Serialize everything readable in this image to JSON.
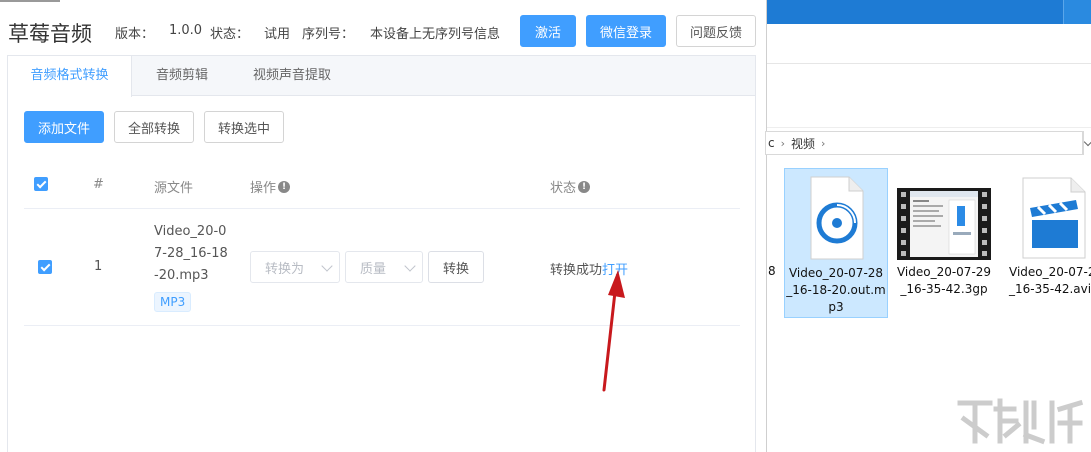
{
  "app": {
    "title": "草莓音频",
    "version_label": "版本：",
    "version_value": "1.0.0",
    "status_label": "状态：",
    "status_value": "试用",
    "serial_label": "序列号：",
    "serial_value": "本设备上无序列号信息",
    "activate_label": "激活",
    "wechat_login_label": "微信登录",
    "feedback_label": "问题反馈"
  },
  "tabs": [
    {
      "label": "音频格式转换",
      "active": true
    },
    {
      "label": "音频剪辑",
      "active": false
    },
    {
      "label": "视频声音提取",
      "active": false
    }
  ],
  "toolbar": {
    "add_file_label": "添加文件",
    "convert_all_label": "全部转换",
    "convert_selected_label": "转换选中"
  },
  "table": {
    "headers": {
      "index": "#",
      "source": "源文件",
      "action": "操作",
      "status": "状态"
    },
    "rows": [
      {
        "checked": true,
        "index": "1",
        "file_name_lines": [
          "Video_20-0",
          "7-28_16-18",
          "-20.mp3"
        ],
        "format_tag": "MP3",
        "convert_to_placeholder": "转换为",
        "quality_placeholder": "质量",
        "convert_label": "转换",
        "status_text": "转换成功",
        "open_label": "打开"
      }
    ]
  },
  "explorer": {
    "breadcrumb_fragment": "c",
    "breadcrumb_folder": "视频",
    "partial_left_text": "8",
    "files": [
      {
        "name_lines": [
          "Video_20-07-28",
          "_16-18-20.out.m",
          "p3"
        ],
        "icon": "audio-file-icon",
        "selected": true
      },
      {
        "name_lines": [
          "Video_20-07-29",
          "_16-35-42.3gp"
        ],
        "icon": "video-thumbnail-icon",
        "selected": false
      },
      {
        "name_lines": [
          "Video_20-07-2",
          "_16-35-42.avi"
        ],
        "icon": "clapperboard-file-icon",
        "selected": false
      }
    ]
  },
  "colors": {
    "primary": "#409eff",
    "explorer_titlebar": "#1e7bd4",
    "selection": "#cce8ff",
    "annotation_arrow": "#c8191d"
  }
}
